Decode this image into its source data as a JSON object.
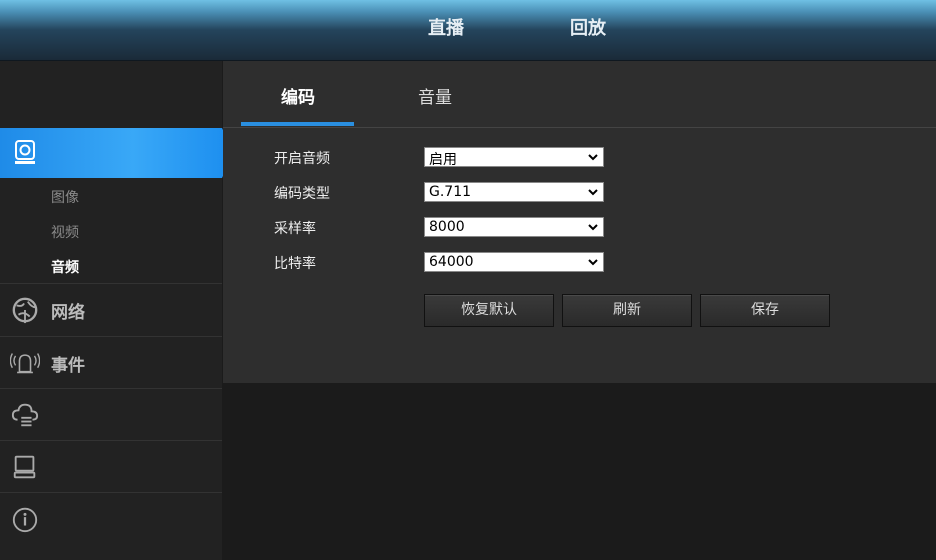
{
  "header": {
    "nav_live": "直播",
    "nav_playback": "回放"
  },
  "sidebar": {
    "active_section_icon": "camera-icon",
    "sub_items": [
      "图像",
      "视频",
      "音频"
    ],
    "active_sub_item": "音频",
    "sections": [
      {
        "icon": "network-globe-icon",
        "label": "网络"
      },
      {
        "icon": "alarm-bell-icon",
        "label": "事件"
      },
      {
        "icon": "cloud-storage-icon",
        "label": ""
      },
      {
        "icon": "computer-system-icon",
        "label": ""
      },
      {
        "icon": "info-icon",
        "label": ""
      }
    ]
  },
  "tabs": {
    "encode": "编码",
    "volume": "音量",
    "active": "编码"
  },
  "form": {
    "enable_audio_label": "开启音频",
    "enable_audio_value": "启用",
    "codec_type_label": "编码类型",
    "codec_type_value": "G.711",
    "sample_rate_label": "采样率",
    "sample_rate_value": "8000",
    "bitrate_label": "比特率",
    "bitrate_value": "64000"
  },
  "buttons": {
    "restore_default": "恢复默认",
    "refresh": "刷新",
    "save": "保存"
  },
  "colors": {
    "accent": "#2a8fe0",
    "active_sidebar": "#1e90f0"
  }
}
